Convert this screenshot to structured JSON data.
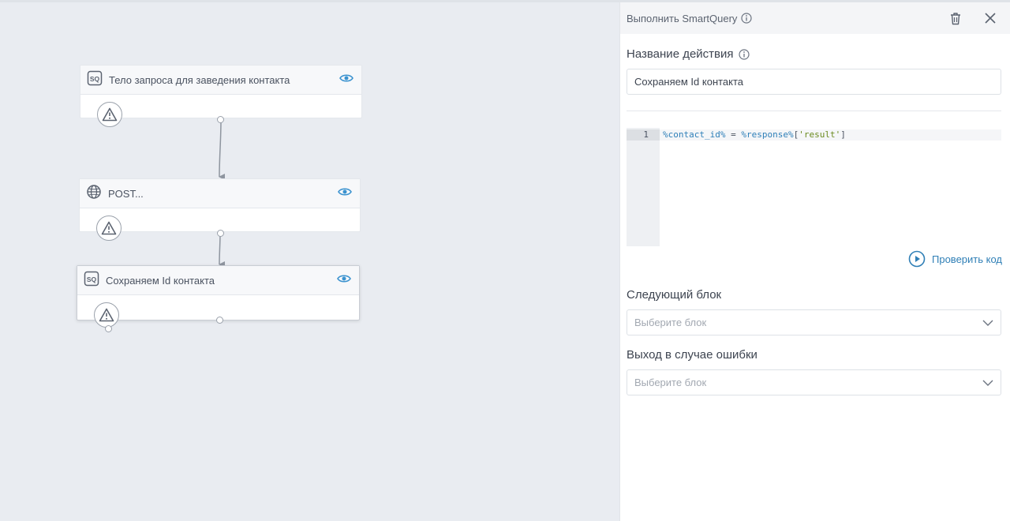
{
  "canvas": {
    "nodes": [
      {
        "title": "Тело запроса для заведения контакта",
        "icon": "sq-icon"
      },
      {
        "title": "POST...",
        "icon": "globe-icon"
      },
      {
        "title": "Сохраняем Id контакта",
        "icon": "sq-icon"
      }
    ]
  },
  "panel": {
    "title": "Выполнить SmartQuery",
    "action_name_label": "Название действия",
    "action_name_value": "Сохраняем Id контакта",
    "code": {
      "line_number": "1",
      "tokens": {
        "var1": "%contact_id%",
        "eq": " = ",
        "var2": "%response%",
        "open": "[",
        "str": "'result'",
        "close": "]"
      }
    },
    "check_code_label": "Проверить код",
    "next_block_label": "Следующий блок",
    "next_block_placeholder": "Выберите блок",
    "error_exit_label": "Выход в случае ошибки",
    "error_exit_placeholder": "Выберите блок"
  },
  "colors": {
    "accent": "#2f7fb6",
    "canvas_bg": "#e9ecf1"
  }
}
